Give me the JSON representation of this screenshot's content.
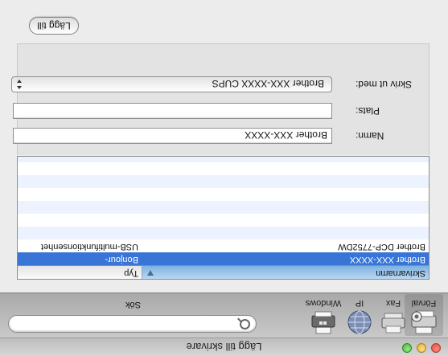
{
  "window": {
    "title": "Lägg till skrivare"
  },
  "toolbar": {
    "items": [
      {
        "label": "Förval",
        "icon": "printer-default-icon",
        "selected": true
      },
      {
        "label": "Fax",
        "icon": "fax-icon"
      },
      {
        "label": "IP",
        "icon": "globe-ip-icon"
      },
      {
        "label": "Windows",
        "icon": "windows-printer-icon"
      }
    ],
    "search": {
      "label": "Sök",
      "placeholder": ""
    }
  },
  "printer_list": {
    "columns": [
      "Skrivarnamn",
      "Typ"
    ],
    "rows": [
      {
        "name": "Brother XXX-XXXX",
        "type": "Bonjour-",
        "selected": true
      },
      {
        "name": "Brother DCP-7752DW",
        "type": "USB-multifunktionsenhet",
        "selected": false
      }
    ]
  },
  "form": {
    "name_label": "Namn:",
    "name_value": "Brother XXX-XXXX",
    "location_label": "Plats:",
    "location_value": "",
    "use_label": "Skriv ut med:",
    "use_value": "Brother   XXX-XXXX    CUPS"
  },
  "buttons": {
    "add": "Lägg till"
  }
}
